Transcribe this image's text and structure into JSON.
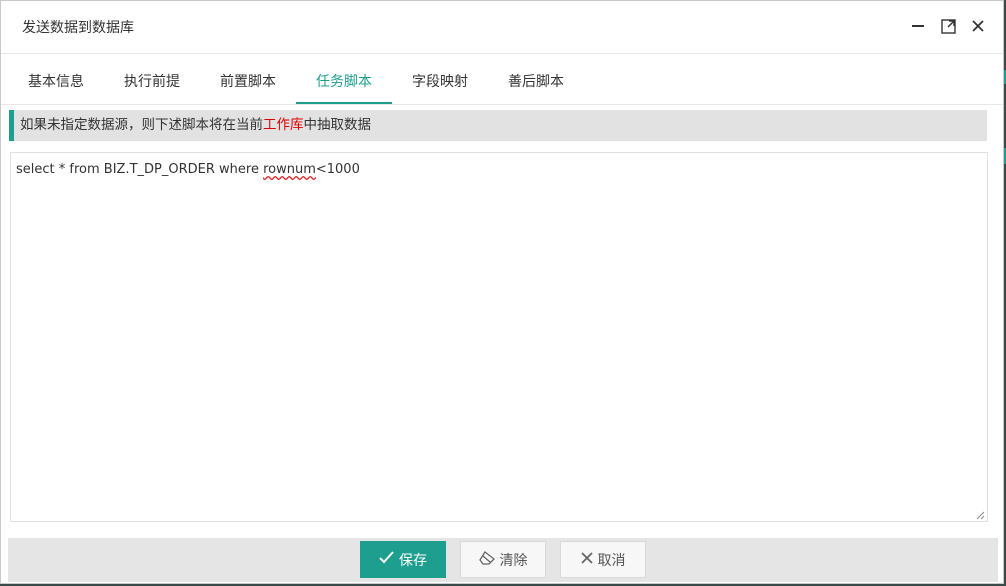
{
  "dialog": {
    "title": "发送数据到数据库",
    "controls": {
      "minimize_icon": "minimize-icon",
      "maximize_icon": "maximize-icon",
      "close_icon": "close-icon"
    }
  },
  "tabs": [
    {
      "label": "基本信息",
      "active": false
    },
    {
      "label": "执行前提",
      "active": false
    },
    {
      "label": "前置脚本",
      "active": false
    },
    {
      "label": "任务脚本",
      "active": true
    },
    {
      "label": "字段映射",
      "active": false
    },
    {
      "label": "善后脚本",
      "active": false
    }
  ],
  "notice": {
    "prefix": "如果未指定数据源，则下述脚本将在当前",
    "highlight": "工作库",
    "suffix": "中抽取数据"
  },
  "editor": {
    "text_before": "select * from BIZ.T_DP_ORDER where ",
    "misspelled": "rownum",
    "text_after": "<1000"
  },
  "footer": {
    "save_label": "保存",
    "clear_label": "清除",
    "cancel_label": "取消"
  },
  "colors": {
    "accent": "#1e9e8f",
    "highlight": "#e00000"
  }
}
